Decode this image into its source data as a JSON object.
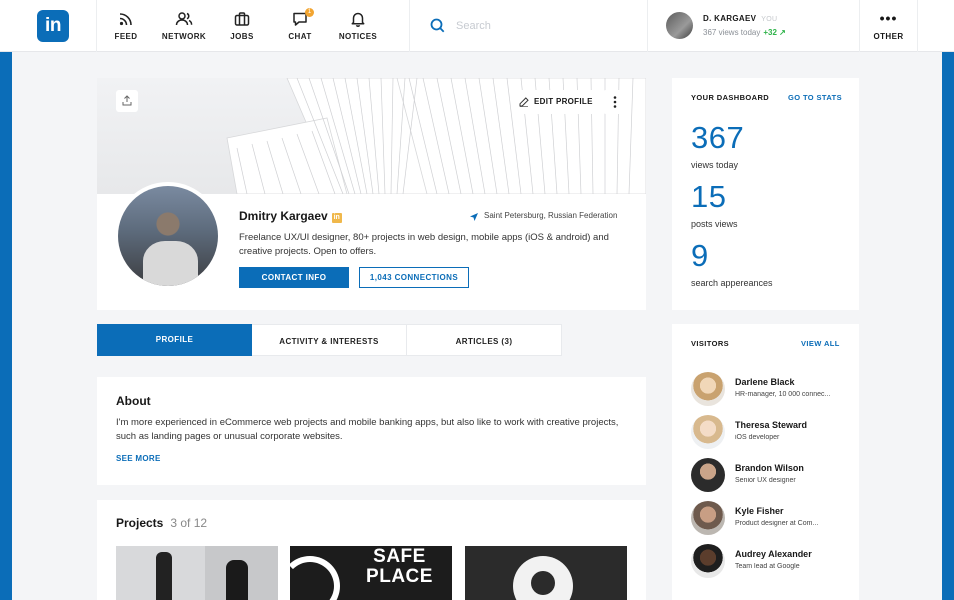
{
  "nav": {
    "logo": "in",
    "items": [
      {
        "label": "FEED",
        "icon": "rss-icon"
      },
      {
        "label": "NETWORK",
        "icon": "users-icon"
      },
      {
        "label": "JOBS",
        "icon": "briefcase-icon"
      },
      {
        "label": "CHAT",
        "icon": "chat-icon",
        "badge": "1"
      },
      {
        "label": "NOTICES",
        "icon": "bell-icon"
      }
    ],
    "search_placeholder": "Search",
    "user": {
      "name": "D. KARGAEV",
      "you": "YOU",
      "views": "367 views today",
      "views_delta": "+32 ↗"
    },
    "other_label": "OTHER"
  },
  "profile": {
    "edit_label": "EDIT PROFILE",
    "name": "Dmitry Kargaev",
    "badge": "in",
    "location": "Saint Petersburg, Russian Federation",
    "bio": "Freelance UX/UI designer, 80+ projects in web design, mobile apps  (iOS & android) and creative projects. Open to offers.",
    "contact_label": "CONTACT INFO",
    "connections_label": "1,043 CONNECTIONS"
  },
  "tabs": [
    {
      "label": "PROFILE",
      "active": true
    },
    {
      "label": "ACTIVITY & INTERESTS",
      "active": false
    },
    {
      "label": "ARTICLES (3)",
      "active": false
    }
  ],
  "about": {
    "title": "About",
    "text": "I'm more experienced in eCommerce web projects and mobile banking apps, but also like to work with creative projects, such as landing pages or unusual corporate websites.",
    "see_more": "SEE MORE"
  },
  "projects": {
    "title": "Projects",
    "count": "3 of 12",
    "thumb2_text": "SAFE PLACE"
  },
  "dashboard": {
    "title": "YOUR DASHBOARD",
    "link": "GO TO STATS",
    "stats": [
      {
        "value": "367",
        "label": "views today"
      },
      {
        "value": "15",
        "label": "posts views"
      },
      {
        "value": "9",
        "label": "search appereances"
      }
    ]
  },
  "visitors": {
    "title": "VISITORS",
    "link": "VIEW ALL",
    "list": [
      {
        "name": "Darlene Black",
        "role": "HR-manager, 10 000 connec..."
      },
      {
        "name": "Theresa Steward",
        "role": "iOS developer"
      },
      {
        "name": "Brandon Wilson",
        "role": "Senior UX designer"
      },
      {
        "name": "Kyle Fisher",
        "role": "Product designer at Com..."
      },
      {
        "name": "Audrey Alexander",
        "role": "Team lead at Google"
      }
    ]
  },
  "colors": {
    "accent": "#0b6db8",
    "badge": "#f2a531",
    "positive": "#2fb34a"
  }
}
